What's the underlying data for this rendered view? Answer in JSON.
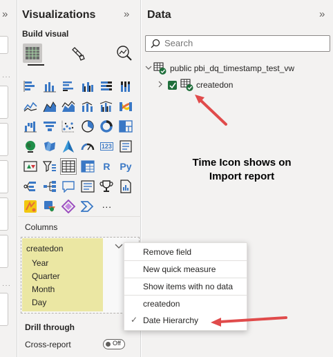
{
  "visualizations": {
    "title": "Visualizations",
    "build_visual_label": "Build visual",
    "columns_label": "Columns",
    "field": {
      "name": "createdon",
      "hierarchy": [
        "Year",
        "Quarter",
        "Month",
        "Day"
      ]
    },
    "drill_through_label": "Drill through",
    "cross_report_label": "Cross-report",
    "cross_report_toggle": "Off",
    "text_icons": {
      "r": "R",
      "py": "Py",
      "num": "123",
      "more": "···"
    }
  },
  "data_pane": {
    "title": "Data",
    "search_placeholder": "Search",
    "table_name": "public pbi_dq_timestamp_test_vw",
    "field_name": "createdon"
  },
  "annotation": {
    "line1": "Time Icon shows on",
    "line2": "Import report"
  },
  "context_menu": {
    "items": [
      "Remove field",
      "New quick measure",
      "Show items with no data",
      "createdon",
      "Date Hierarchy"
    ],
    "checked_item": "Date Hierarchy"
  },
  "colors": {
    "pane_bg": "#f3f2f1",
    "hierarchy_highlight": "#ebe7a3",
    "annotation_arrow": "#e04b4b",
    "checkbox_green": "#1f6f3b",
    "icon_blue": "#3a78c5"
  }
}
